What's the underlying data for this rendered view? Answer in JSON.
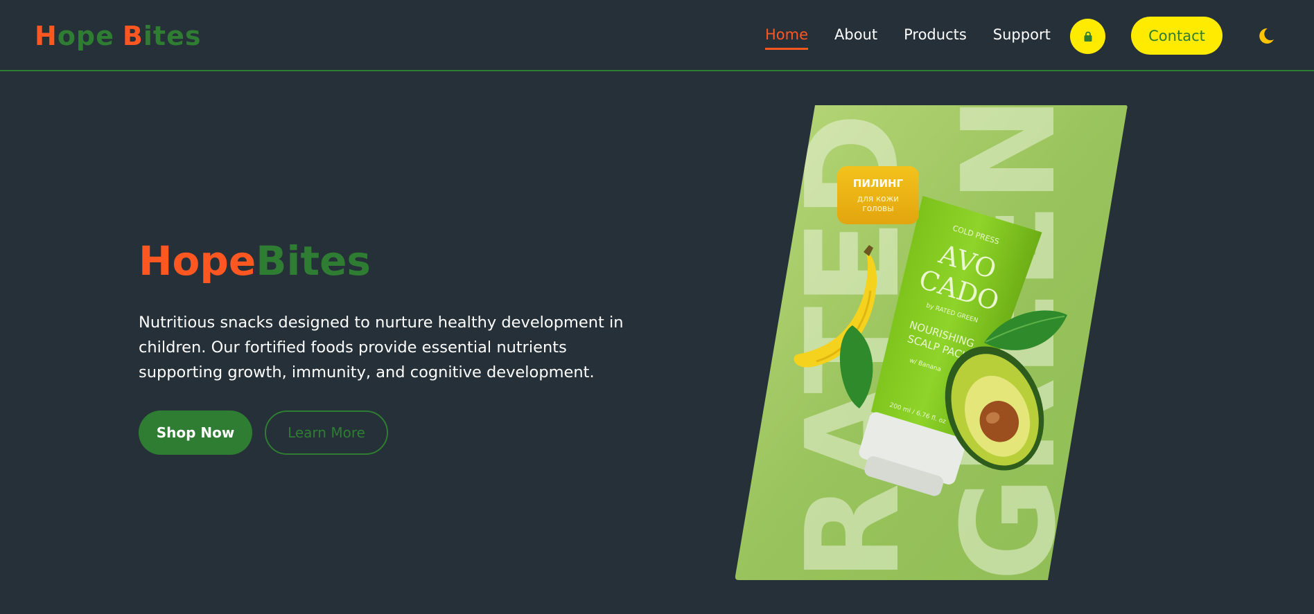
{
  "brand": {
    "logo_first_cap": "H",
    "logo_first_rest": "ope",
    "logo_second_cap": "B",
    "logo_second_rest": "ites",
    "colors": {
      "orange": "#ff5722",
      "green": "#2e7d32",
      "yellow": "#ffeb00",
      "background": "#263038"
    }
  },
  "nav": {
    "items": [
      {
        "label": "Home",
        "active": true
      },
      {
        "label": "About",
        "active": false
      },
      {
        "label": "Products",
        "active": false
      },
      {
        "label": "Support",
        "active": false
      }
    ],
    "cart_icon": "shopping-bag-icon",
    "contact_label": "Contact",
    "theme_icon": "moon-icon"
  },
  "hero": {
    "title_part1": "Hope",
    "title_part2": "Bites",
    "description": "Nutritious snacks designed to nurture healthy development in children. Our fortified foods provide essential nutrients supporting growth, immunity, and cognitive development.",
    "primary_button": "Shop Now",
    "secondary_button": "Learn More"
  },
  "product_image": {
    "label_title": "ПИЛИНГ",
    "label_sub1": "для кожи",
    "label_sub2": "головы",
    "brand_top": "COLD PRESS",
    "name_line1": "AVO",
    "name_line2": "CADO",
    "by_line": "by RATED GREEN",
    "desc_line1": "NOURISHING",
    "desc_line2": "SCALP PACK",
    "with_line": "w/ Banana",
    "volume": "200 ml / 6.76 fl. oz",
    "bg_word1": "RATED",
    "bg_word2": "GREEN"
  }
}
